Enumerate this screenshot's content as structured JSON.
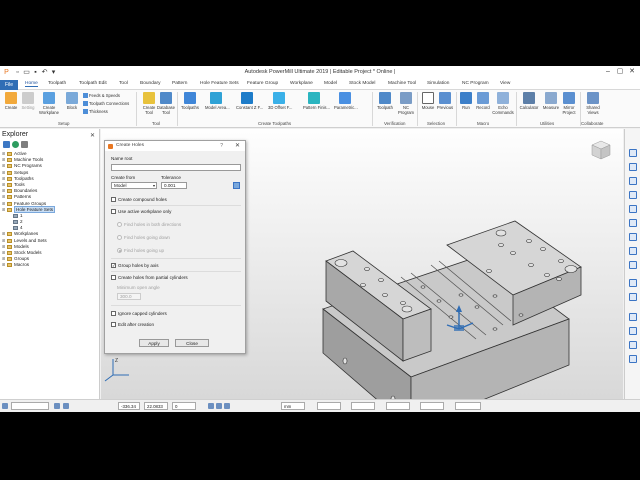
{
  "window": {
    "title": "Autodesk PowerMill Ultimate 2019  |  Editable Project * Online |"
  },
  "tabs": [
    "Home",
    "Toolpath",
    "Toolpath Edit",
    "Tool",
    "Boundary",
    "Pattern",
    "Hole Feature Sets",
    "Feature Group",
    "Workplane",
    "Model",
    "Stock Model",
    "Machine Tool",
    "Simulation",
    "NC Program",
    "View"
  ],
  "file_tab": "File",
  "ribbon": {
    "setup": {
      "create": "Create",
      "setting": "Setting",
      "workplane": "Create\nWorkplane",
      "block": "Block",
      "feeds": "Feeds & Speeds",
      "connections": "Toolpath Connections",
      "thickness": "Thickness",
      "group": "Setup"
    },
    "tool": {
      "create_tool": "Create\nTool",
      "database": "Database\nTool",
      "group": "Tool"
    },
    "toolpaths": {
      "items": [
        "Toolpaths",
        "Model Area...",
        "Constant Z F...",
        "3D Offset F...",
        "Pattern Finis...",
        "Parametric..."
      ],
      "group": "Create Toolpaths"
    },
    "verification": {
      "items": [
        "Toolpath",
        "NC\nProgram"
      ],
      "group": "Verification"
    },
    "selection": {
      "items": [
        "Mouse",
        "Previous"
      ],
      "group": "Selection"
    },
    "macro": {
      "items": [
        "Run",
        "Record",
        "Echo\nCommands"
      ],
      "group": "Macro"
    },
    "utilities": {
      "items": [
        "Calculator",
        "Measure",
        "Mirror\nProject"
      ],
      "group": "Utilities"
    },
    "collaborate": {
      "items": [
        "Shared\nViews"
      ],
      "group": "Collaborate"
    }
  },
  "explorer": {
    "title": "Explorer",
    "items": [
      {
        "label": "Active"
      },
      {
        "label": "Machine Tools"
      },
      {
        "label": "NC Programs"
      },
      {
        "label": "Setups"
      },
      {
        "label": "Toolpaths"
      },
      {
        "label": "Tools"
      },
      {
        "label": "Boundaries"
      },
      {
        "label": "Patterns"
      },
      {
        "label": "Feature Groups"
      },
      {
        "label": "Hole Feature Sets",
        "selected": true
      },
      {
        "label": "1",
        "sub": true
      },
      {
        "label": "2",
        "sub": true
      },
      {
        "label": "4",
        "sub": true
      },
      {
        "label": "Workplanes"
      },
      {
        "label": "Levels and Sets"
      },
      {
        "label": "Models"
      },
      {
        "label": "Stock Models"
      },
      {
        "label": "Groups"
      },
      {
        "label": "Macros"
      }
    ]
  },
  "dialog": {
    "title": "Create Holes",
    "help": "?",
    "name_root_label": "Name root",
    "name_root_value": "",
    "create_from_label": "Create from",
    "create_from_value": "Model",
    "tolerance_label": "Tolerance",
    "tolerance_value": "0.001",
    "compound_holes": "Create compound holes",
    "active_workplane_only": "Use active workplane only",
    "find_both": "Find holes in both directions",
    "find_down": "Find holes going down",
    "find_up": "Find holes going up",
    "group_by_axis": "Group holes by axis",
    "partial_cylinders": "Create holes from partial cylinders",
    "min_open_angle_label": "Minimum open angle",
    "min_open_angle_value": "300.0",
    "ignore_capped": "Ignore capped cylinders",
    "edit_after": "Edit after creation",
    "apply": "Apply",
    "close": "Close"
  },
  "statusbar": {
    "x": "-336.34",
    "y": "22.0833",
    "z": "0",
    "units": "mm"
  },
  "colors": {
    "accent": "#2f6db5",
    "hole_feature": "#2f6db5"
  }
}
